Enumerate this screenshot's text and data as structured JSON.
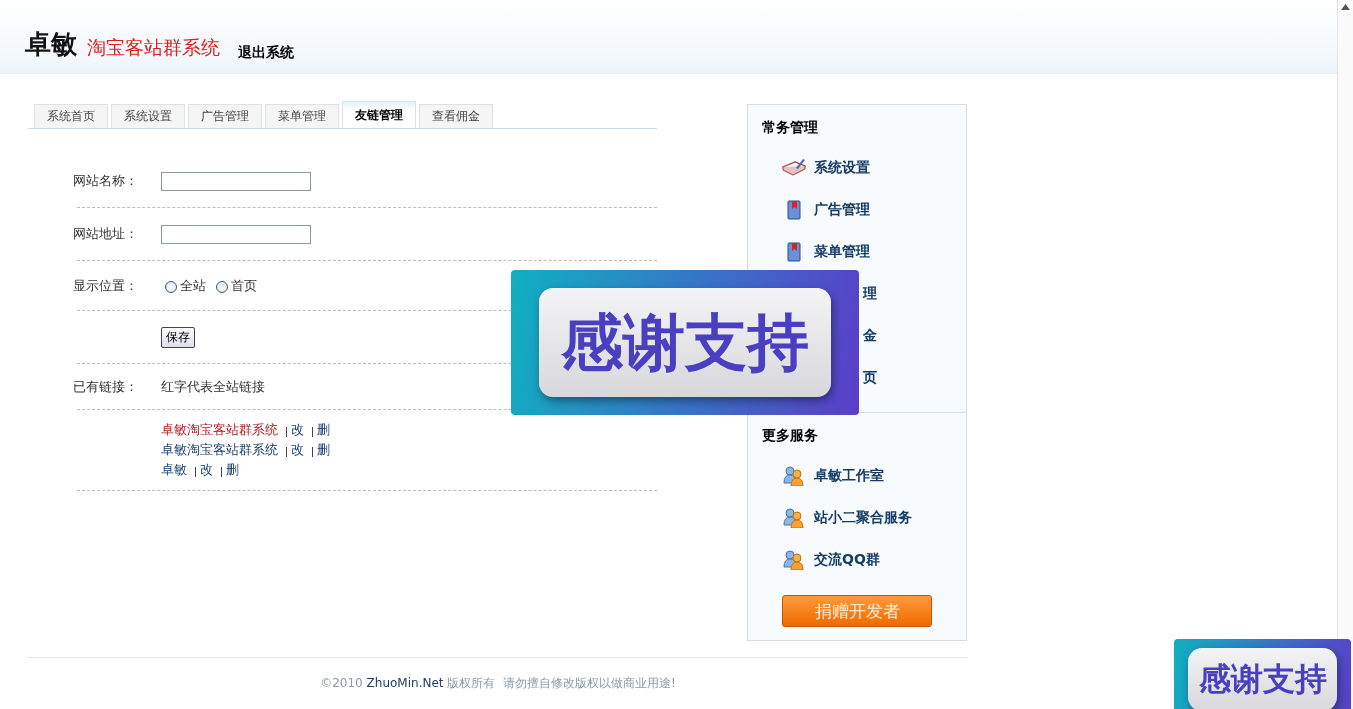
{
  "header": {
    "logo_main": "卓敏",
    "logo_sub": "淘宝客站群系统",
    "logout": "退出系统"
  },
  "tabs": [
    {
      "label": "系统首页",
      "selected": false
    },
    {
      "label": "系统设置",
      "selected": false
    },
    {
      "label": "广告管理",
      "selected": false
    },
    {
      "label": "菜单管理",
      "selected": false
    },
    {
      "label": "友链管理",
      "selected": true
    },
    {
      "label": "查看佣金",
      "selected": false
    }
  ],
  "form": {
    "fields": [
      {
        "label": "网站名称：",
        "kind": "text"
      },
      {
        "label": "网站地址：",
        "kind": "text"
      },
      {
        "label": "显示位置：",
        "kind": "radio",
        "options": [
          {
            "label": "全站",
            "selected": false
          },
          {
            "label": "首页",
            "selected": false
          }
        ]
      }
    ],
    "save_button": "保存",
    "existing_label": "已有链接：",
    "existing_note": "红字代表全站链接",
    "links": [
      {
        "name": "卓敏淘宝客站群系统",
        "sitewide": true,
        "edit": "改",
        "delete": "删"
      },
      {
        "name": "卓敏淘宝客站群系统",
        "sitewide": false,
        "edit": "改",
        "delete": "删"
      },
      {
        "name": "卓敏",
        "sitewide": false,
        "edit": "改",
        "delete": "删"
      }
    ]
  },
  "sidebar": {
    "sections": [
      {
        "title": "常务管理",
        "items": [
          {
            "label": "系统设置",
            "kind": "book"
          },
          {
            "label": "广告管理",
            "kind": "bookmark"
          },
          {
            "label": "菜单管理",
            "kind": "bookmark"
          },
          {
            "label": "理",
            "kind": "partial"
          },
          {
            "label": "金",
            "kind": "partial"
          },
          {
            "label": "页",
            "kind": "partial"
          }
        ]
      },
      {
        "title": "更多服务",
        "items": [
          {
            "label": "卓敏工作室",
            "kind": "users"
          },
          {
            "label": "站小二聚合服务",
            "kind": "users"
          },
          {
            "label": "交流QQ群",
            "kind": "users"
          }
        ]
      }
    ],
    "donate_button": "捐赠开发者"
  },
  "footer": {
    "year": "©2010",
    "site": "ZhuoMin.Net",
    "text": "版权所有  请勿擅自修改版权以做商业用途!"
  },
  "banners": [
    {
      "text": "感谢支持"
    },
    {
      "text": "感谢支持"
    }
  ]
}
